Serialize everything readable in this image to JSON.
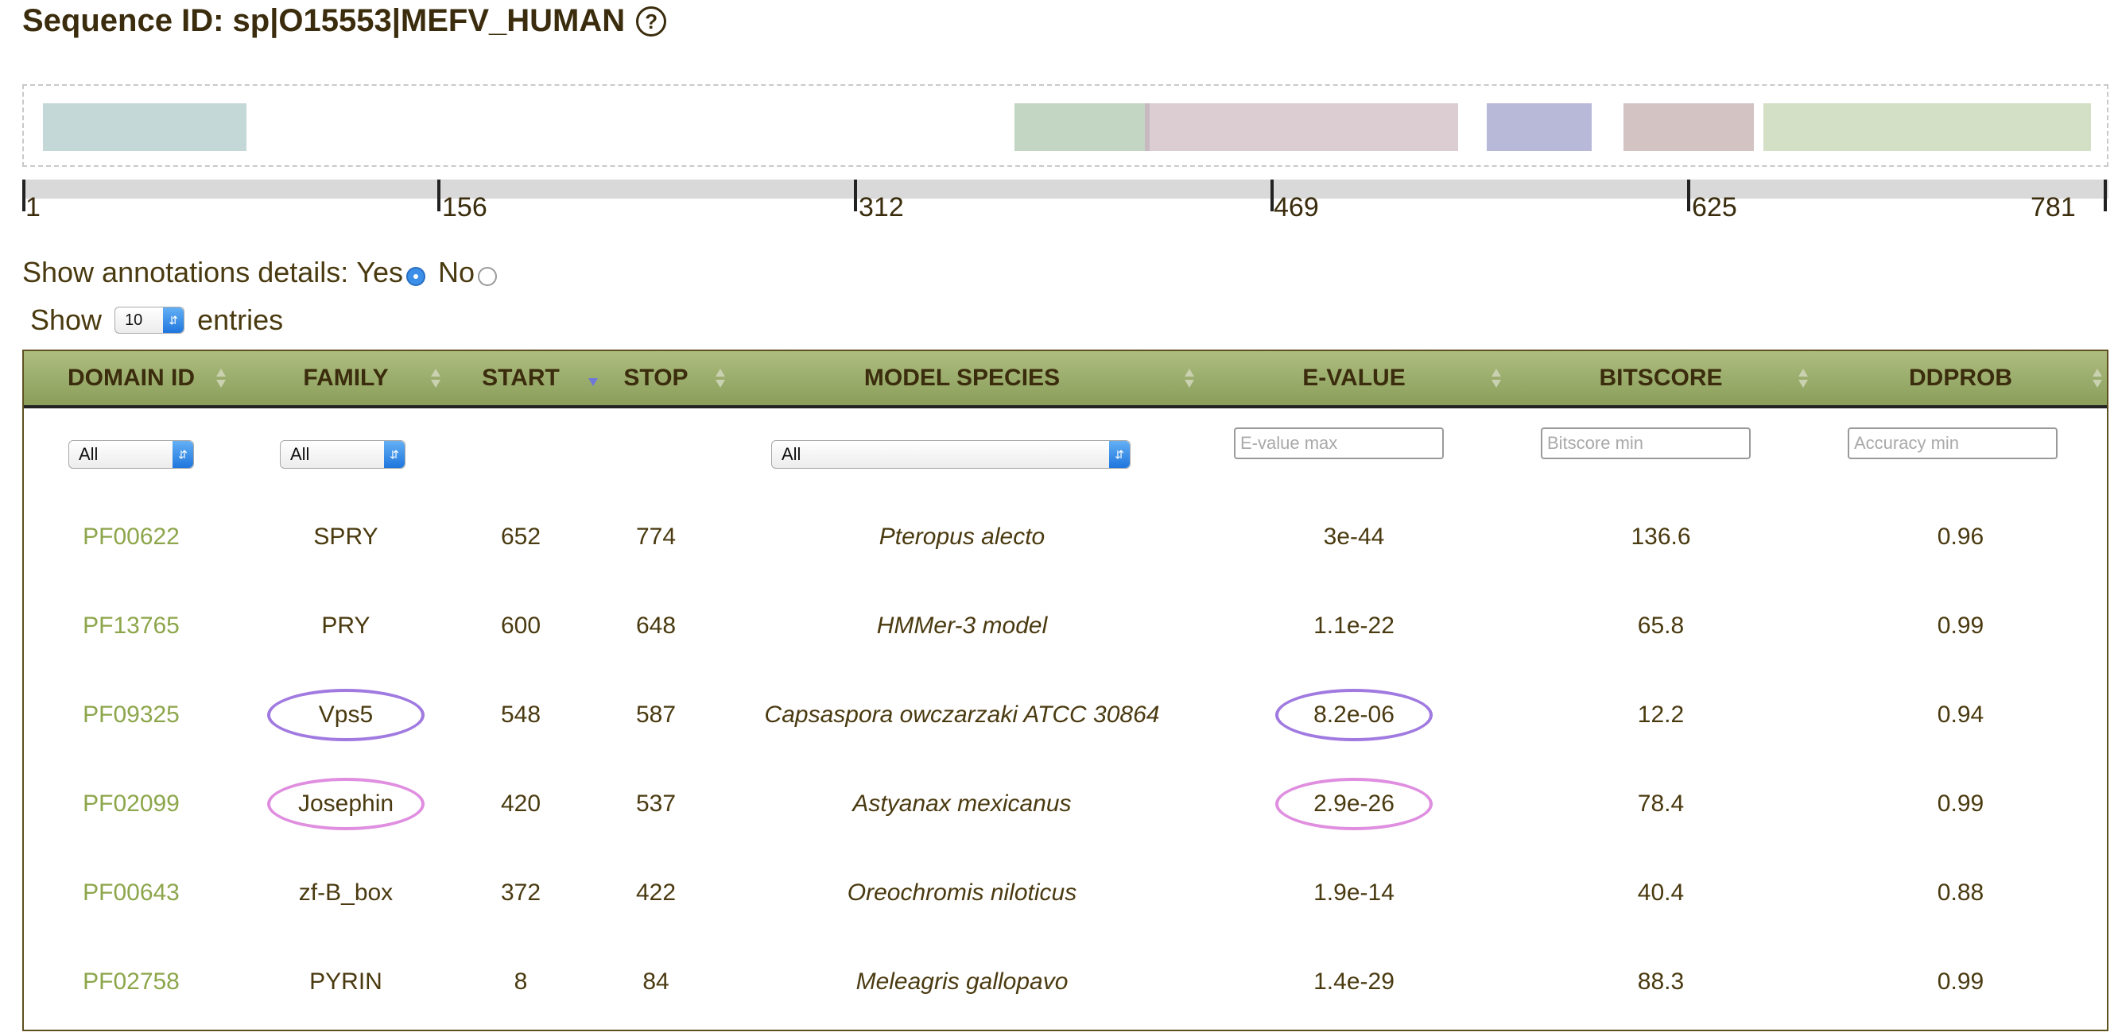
{
  "sequence": {
    "title": "Sequence ID: sp|O15553|MEFV_HUMAN",
    "help_icon": "?"
  },
  "ruler": {
    "ticks": [
      "1",
      "156",
      "312",
      "469",
      "625",
      "781"
    ]
  },
  "annotations_toggle": {
    "label": "Show annotations details:",
    "yes_label": "Yes",
    "no_label": "No",
    "selected": "Yes"
  },
  "entries": {
    "show_label": "Show",
    "count": "10",
    "suffix": "entries"
  },
  "table": {
    "columns": [
      "DOMAIN ID",
      "FAMILY",
      "START",
      "STOP",
      "MODEL SPECIES",
      "E-VALUE",
      "BITSCORE",
      "DDPROB"
    ],
    "sorted_column": "START",
    "filters": {
      "domain_id": "All",
      "family": "All",
      "model_species": "All",
      "evalue_placeholder": "E-value max",
      "bitscore_placeholder": "Bitscore min",
      "accuracy_placeholder": "Accuracy min"
    },
    "rows": [
      {
        "domain_id": "PF00622",
        "family": "SPRY",
        "start": "652",
        "stop": "774",
        "species": "Pteropus alecto",
        "evalue": "3e-44",
        "bitscore": "136.6",
        "ddprob": "0.96"
      },
      {
        "domain_id": "PF13765",
        "family": "PRY",
        "start": "600",
        "stop": "648",
        "species": "HMMer-3 model",
        "evalue": "1.1e-22",
        "bitscore": "65.8",
        "ddprob": "0.99"
      },
      {
        "domain_id": "PF09325",
        "family": "Vps5",
        "start": "548",
        "stop": "587",
        "species": "Capsaspora owczarzaki ATCC 30864",
        "evalue": "8.2e-06",
        "bitscore": "12.2",
        "ddprob": "0.94"
      },
      {
        "domain_id": "PF02099",
        "family": "Josephin",
        "start": "420",
        "stop": "537",
        "species": "Astyanax mexicanus",
        "evalue": "2.9e-26",
        "bitscore": "78.4",
        "ddprob": "0.99"
      },
      {
        "domain_id": "PF00643",
        "family": "zf-B_box",
        "start": "372",
        "stop": "422",
        "species": "Oreochromis niloticus",
        "evalue": "1.9e-14",
        "bitscore": "40.4",
        "ddprob": "0.88"
      },
      {
        "domain_id": "PF02758",
        "family": "PYRIN",
        "start": "8",
        "stop": "84",
        "species": "Meleagris gallopavo",
        "evalue": "1.4e-29",
        "bitscore": "88.3",
        "ddprob": "0.99"
      }
    ]
  },
  "colors": {
    "header_green": "#9aae6a",
    "link_green": "#8da64b",
    "highlight_purple": "#a07ae0",
    "highlight_pink": "#df8ee0",
    "radio_blue": "#3b8fe8"
  }
}
